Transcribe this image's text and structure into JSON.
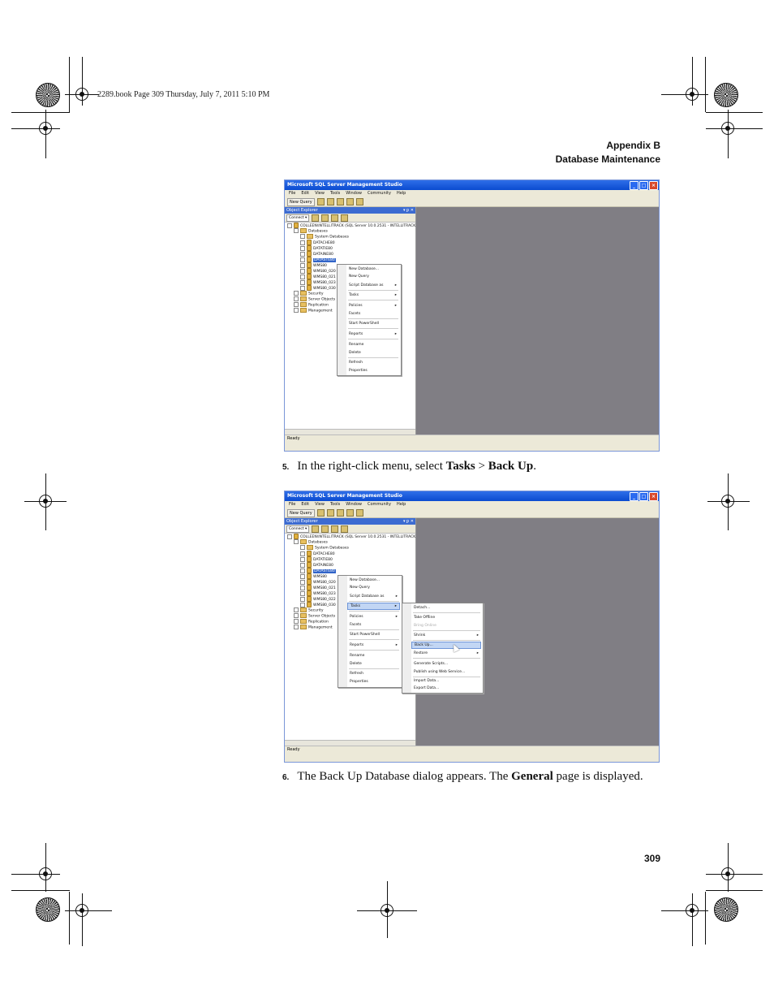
{
  "slug": "2289.book  Page 309  Thursday, July 7, 2011  5:10 PM",
  "header": {
    "line1": "Appendix  B",
    "line2": "Database Maintenance"
  },
  "screen1": {
    "title": "Microsoft SQL Server Management Studio",
    "menus": [
      "File",
      "Edit",
      "View",
      "Tools",
      "Window",
      "Community",
      "Help"
    ],
    "new_query": "New Query",
    "explorer_title": "Object Explorer",
    "explorer_pin": "▾ ꝑ ✕",
    "connect": "Connect ▾",
    "server": "COLLEEN\\INTELLITRACK (SQL Server 10.0.2531 - INTELLITRACK",
    "tree": [
      "Databases",
      "System Databases",
      "DATACHE80",
      "DATATIE80",
      "DATAINE80",
      "DATASTE80",
      "WMS80",
      "WMS80_020",
      "WMS80_021",
      "WMS80_023",
      "WMS80_030",
      "Security",
      "Server Objects",
      "Replication",
      "Management"
    ],
    "menu": [
      "New Database...",
      "New Query",
      "Script Database as",
      "Tasks",
      "Policies",
      "Facets",
      "Start PowerShell",
      "Reports",
      "Rename",
      "Delete",
      "Refresh",
      "Properties"
    ],
    "status": "Ready"
  },
  "step5": {
    "num": "5.",
    "pre": "In the right-click menu, select ",
    "b1": "Tasks",
    "mid": " > ",
    "b2": "Back Up",
    "post": "."
  },
  "screen2": {
    "title": "Microsoft SQL Server Management Studio",
    "menus": [
      "File",
      "Edit",
      "View",
      "Tools",
      "Window",
      "Community",
      "Help"
    ],
    "new_query": "New Query",
    "explorer_title": "Object Explorer",
    "explorer_pin": "▾ ꝑ ✕",
    "connect": "Connect ▾",
    "server": "COLLEEN\\INTELLITRACK (SQL Server 10.0.2531 - INTELLITRACK",
    "tree": [
      "Databases",
      "System Databases",
      "DATACHE80",
      "DATATIE80",
      "DATAINE80",
      "DATASTE80",
      "WMS80",
      "WMS80_020",
      "WMS80_021",
      "WMS80_023",
      "WMS80_022",
      "WMS80_030",
      "Security",
      "Server Objects",
      "Replication",
      "Management"
    ],
    "menu": [
      "New Database...",
      "New Query",
      "Script Database as",
      "Tasks",
      "Policies",
      "Facets",
      "Start PowerShell",
      "Reports",
      "Rename",
      "Delete",
      "Refresh",
      "Properties"
    ],
    "submenu": [
      "Detach...",
      "Take Offline",
      "Bring Online",
      "Shrink",
      "Back Up...",
      "Restore",
      "Generate Scripts...",
      "Publish using Web Service...",
      "Import Data...",
      "Export Data..."
    ],
    "status": "Ready"
  },
  "step6": {
    "num": "6.",
    "pre": "The Back Up Database dialog appears. The ",
    "b1": "General",
    "post": " page is displayed."
  },
  "page_number": "309",
  "arrow_glyph": "▸"
}
